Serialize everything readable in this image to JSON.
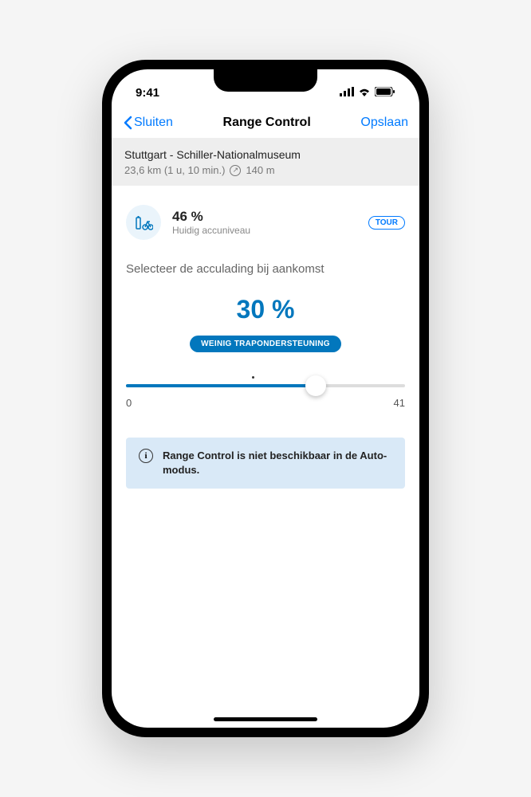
{
  "status": {
    "time": "9:41"
  },
  "nav": {
    "back": "Sluiten",
    "title": "Range Control",
    "save": "Opslaan"
  },
  "route": {
    "title": "Stuttgart - Schiller-Nationalmuseum",
    "distance_time": "23,6 km (1 u, 10 min.)",
    "elevation": "140 m"
  },
  "battery": {
    "percent": "46 %",
    "label": "Huidig accuniveau",
    "mode_badge": "TOUR"
  },
  "target": {
    "select_label": "Selecteer de acculading bij aankomst",
    "percent": "30 %",
    "assist_label": "WEINIG TRAPONDERSTEUNING"
  },
  "slider": {
    "min": "0",
    "max": "41"
  },
  "info": {
    "text": "Range Control is niet beschikbaar in de Auto-modus."
  }
}
